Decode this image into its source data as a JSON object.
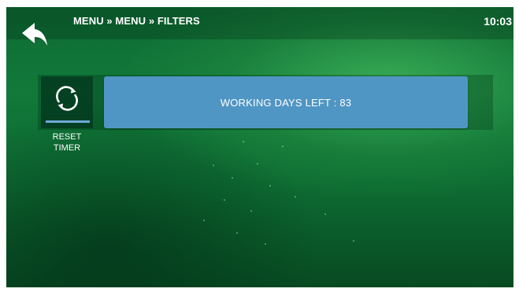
{
  "header": {
    "breadcrumb": "MENU » MENU » FILTERS",
    "time": "10:03"
  },
  "icons": {
    "back": "back-arrow-icon",
    "reset": "refresh-icon"
  },
  "reset_timer": {
    "label": "RESET\nTIMER"
  },
  "filter": {
    "working_days_text": "WORKING DAYS LEFT : 83"
  },
  "colors": {
    "panel": "#5096c4",
    "underline": "#6ea8d8",
    "background": "#0f6b34",
    "text": "#ffffff"
  }
}
